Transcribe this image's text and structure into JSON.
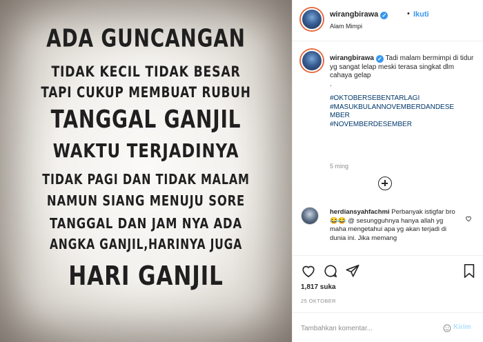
{
  "post_image": {
    "lines": [
      "ADA GUNCANGAN",
      "TIDAK KECIL TIDAK BESAR",
      "TAPI CUKUP MEMBUAT RUBUH",
      "TANGGAL GANJIL",
      "WAKTU TERJADINYA",
      "TIDAK PAGI DAN TIDAK MALAM",
      "NAMUN SIANG MENUJU SORE",
      "TANGGAL DAN JAM NYA ADA",
      "ANGKA GANJIL,HARINYA JUGA",
      "HARI GANJIL"
    ]
  },
  "header": {
    "username": "wirangbirawa",
    "dot": "•",
    "follow_label": "Ikuti",
    "location": "Alam Mimpi"
  },
  "caption": {
    "username": "wirangbirawa",
    "text": "Tadi malam bermimpi di tidur yg sangat lelap meski terasa singkat dlm cahaya gelap",
    "dot": ".",
    "hashtags": [
      "#OKTOBERSEBENTARLAGI",
      "#MASUKBULANNOVEMBERDANDESE MBER",
      "#NOVEMBERDESEMBER"
    ],
    "time": "5 ming"
  },
  "comment": {
    "username": "herdiansyahfachmi",
    "text": "Perbanyak istigfar bro 😂😂 @ sesungguhnya hanya allah yg maha mengetahui apa yg akan terjadi di dunia ini. Jika memang"
  },
  "stats": {
    "likes": "1,817 suka",
    "date": "25 OKTOBER"
  },
  "add_comment": {
    "placeholder": "Tambahkan komentar...",
    "send_label": "Kirim"
  },
  "icons": {
    "like": "heart-icon",
    "comment": "comment-icon",
    "share": "share-icon",
    "save": "bookmark-icon",
    "emoji": "smiley-icon",
    "more": "plus-circle-icon",
    "comment_like": "heart-icon"
  },
  "colors": {
    "link_blue": "#3897f0",
    "hashtag": "#00376b",
    "muted": "#8e8e8e",
    "send_disabled": "#b2dffc"
  }
}
